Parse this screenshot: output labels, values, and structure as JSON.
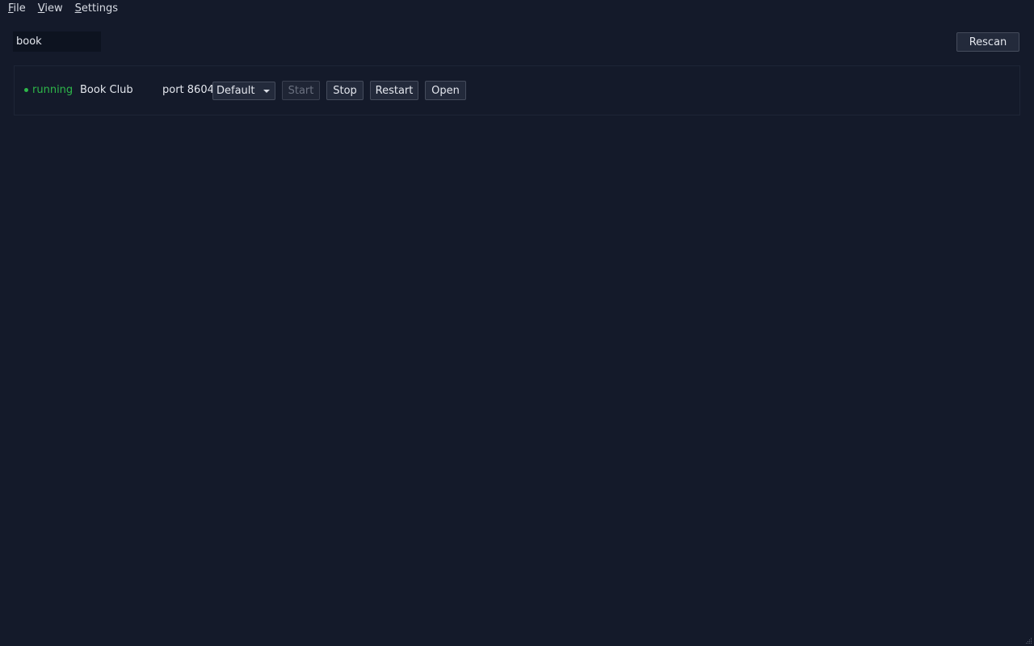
{
  "menu": {
    "items": [
      {
        "label_first": "F",
        "label_rest": "ile"
      },
      {
        "label_first": "V",
        "label_rest": "iew"
      },
      {
        "label_first": "S",
        "label_rest": "ettings"
      }
    ]
  },
  "toolbar": {
    "search_value": "book",
    "rescan_label": "Rescan"
  },
  "project": {
    "status": "running",
    "name": "Book Club",
    "port": "port 8604",
    "profile_selected": "Default",
    "buttons": {
      "start": "Start",
      "stop": "Stop",
      "restart": "Restart",
      "open": "Open"
    }
  },
  "colors": {
    "background": "#141a2a",
    "status_running": "#2eb84a"
  },
  "icons": {
    "status": "status-dot-icon",
    "dropdown": "chevron-down-icon",
    "resize": "resize-grip-icon"
  }
}
